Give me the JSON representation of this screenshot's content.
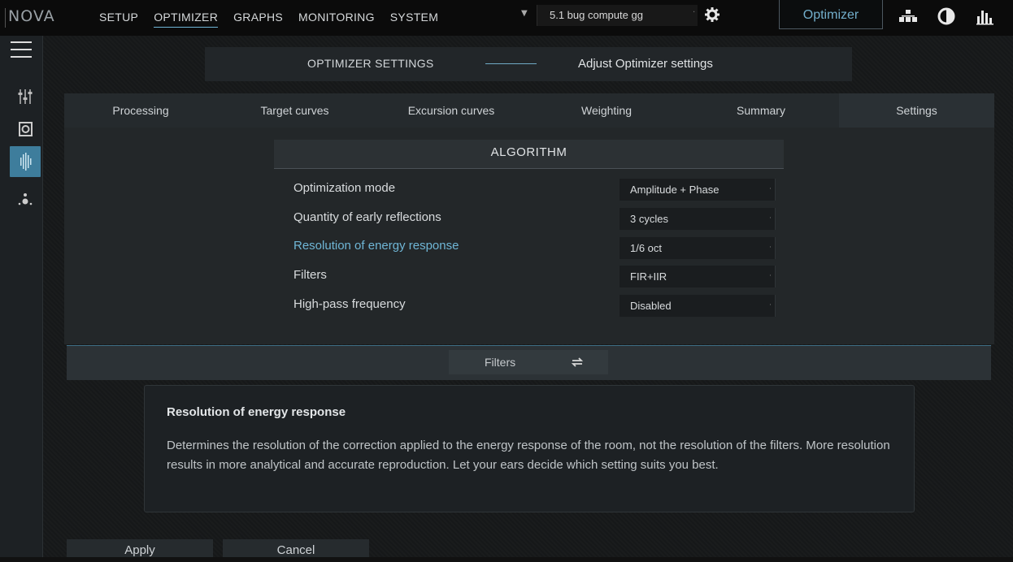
{
  "app": {
    "logo": "NOVA"
  },
  "nav": {
    "items": [
      "SETUP",
      "OPTIMIZER",
      "GRAPHS",
      "MONITORING",
      "SYSTEM"
    ],
    "active": "OPTIMIZER"
  },
  "preset": {
    "label": "5.1 bug compute gg"
  },
  "top_button": {
    "label": "Optimizer"
  },
  "header": {
    "left": "OPTIMIZER SETTINGS",
    "right": "Adjust Optimizer settings"
  },
  "tabs": [
    "Processing",
    "Target curves",
    "Excursion curves",
    "Weighting",
    "Summary",
    "Settings"
  ],
  "active_tab": "Settings",
  "algorithm": {
    "title": "ALGORITHM",
    "rows": [
      {
        "label": "Optimization mode",
        "value": "Amplitude + Phase"
      },
      {
        "label": "Quantity of early reflections",
        "value": "3 cycles"
      },
      {
        "label": "Resolution of energy response",
        "value": "1/6 oct"
      },
      {
        "label": "Filters",
        "value": "FIR+IIR"
      },
      {
        "label": "High-pass frequency",
        "value": "Disabled"
      }
    ]
  },
  "filters_button": {
    "label": "Filters"
  },
  "info": {
    "title": "Resolution of energy response",
    "body": "Determines the resolution of the correction applied to the energy response of the room, not the resolution of the filters. More resolution results in more analytical and accurate reproduction. Let your ears decide which setting suits you best."
  },
  "actions": {
    "apply": "Apply",
    "cancel": "Cancel"
  },
  "colors": {
    "accent": "#6fb6d6",
    "sidebar_active": "#3e7d9c",
    "background": "#161819"
  },
  "icons": {
    "gear": "gear-icon",
    "speaker_layout": "speaker-layout-icon",
    "level": "level-icon",
    "bars": "bars-icon",
    "menu": "menu-icon",
    "mixer": "mixer-icon",
    "speaker": "speaker-icon",
    "waveform": "waveform-icon",
    "listener": "listener-icon",
    "swap": "swap-icon"
  }
}
